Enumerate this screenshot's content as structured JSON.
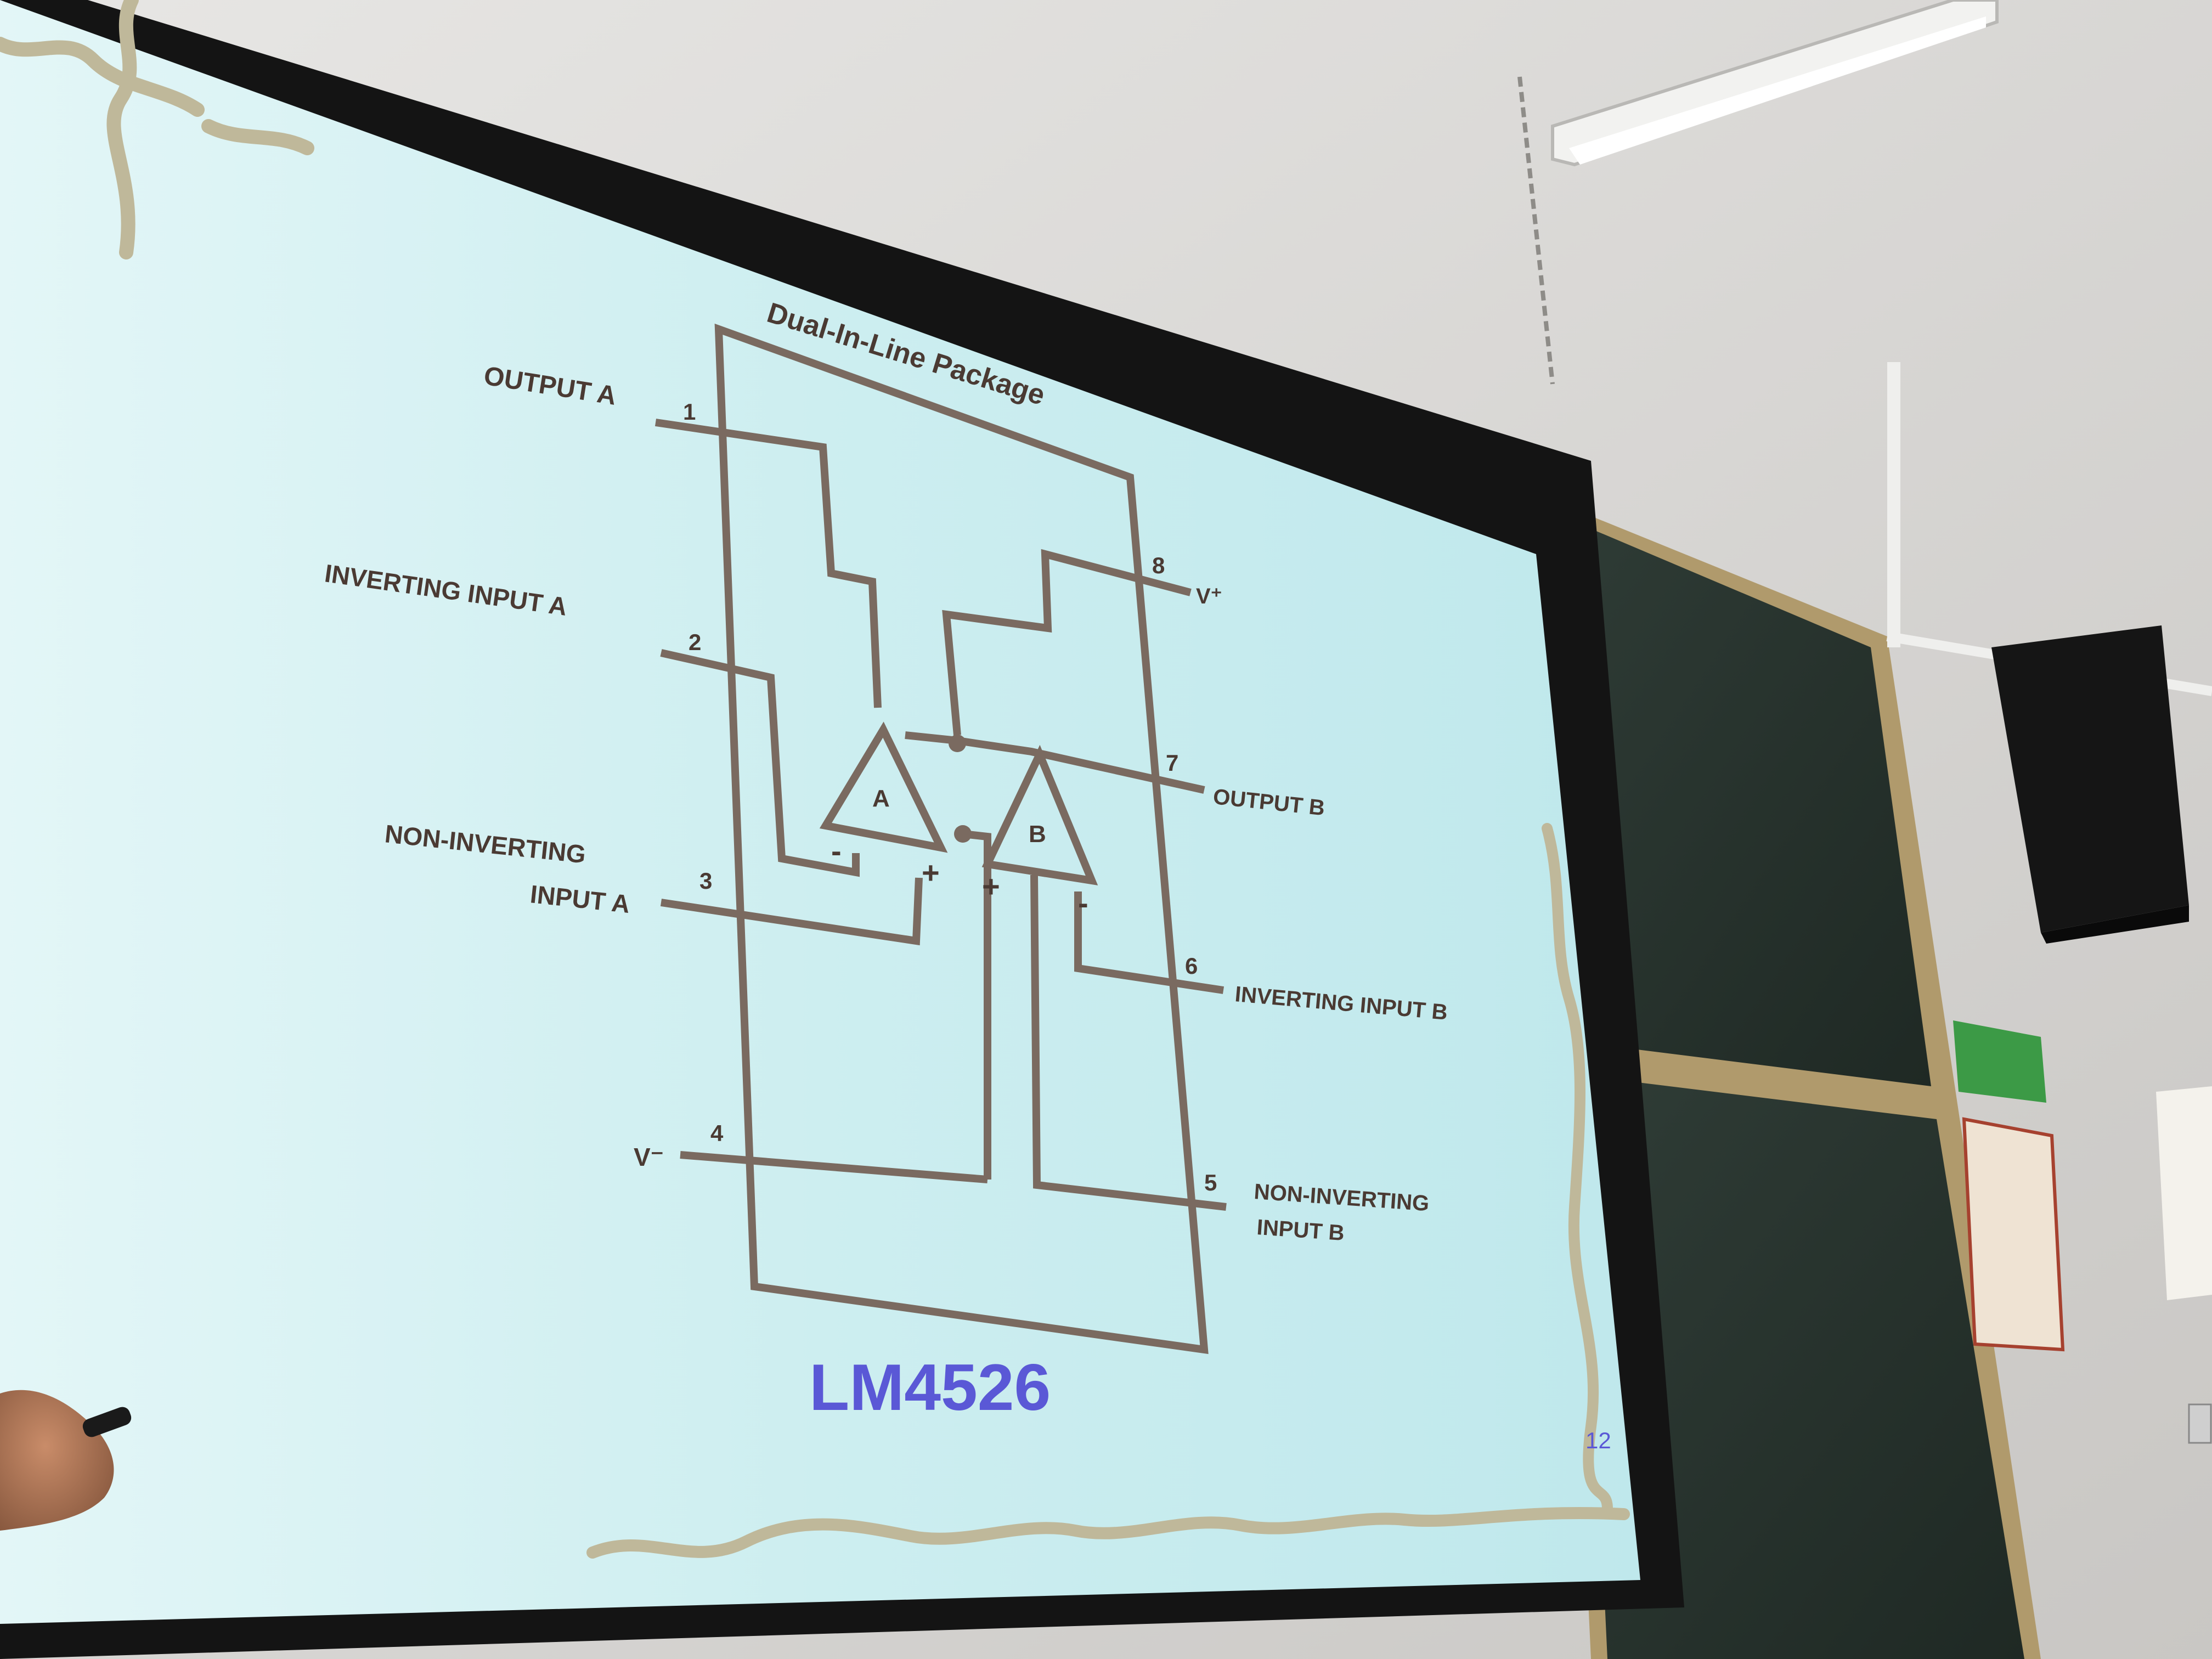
{
  "slide": {
    "package_title": "Dual-In-Line Package",
    "part_number": "LM4526",
    "page_number": "12",
    "opamp_a_label": "A",
    "opamp_b_label": "B",
    "minus_sign": "-",
    "plus_sign": "+",
    "pins": [
      {
        "number": "1",
        "label": "OUTPUT A"
      },
      {
        "number": "2",
        "label": "INVERTING INPUT A"
      },
      {
        "number": "3",
        "label_line1": "NON-INVERTING",
        "label_line2": "INPUT A"
      },
      {
        "number": "4",
        "label": "V⁻"
      },
      {
        "number": "5",
        "label_line1": "NON-INVERTING",
        "label_line2": "INPUT B"
      },
      {
        "number": "6",
        "label": "INVERTING INPUT B"
      },
      {
        "number": "7",
        "label": "OUTPUT B"
      },
      {
        "number": "8",
        "label": "V⁺"
      }
    ]
  },
  "colors": {
    "slide_bg": "#cdeef0",
    "trace": "#7a6a60",
    "part_number": "#5a58d6",
    "chalkboard": "#27332e"
  }
}
